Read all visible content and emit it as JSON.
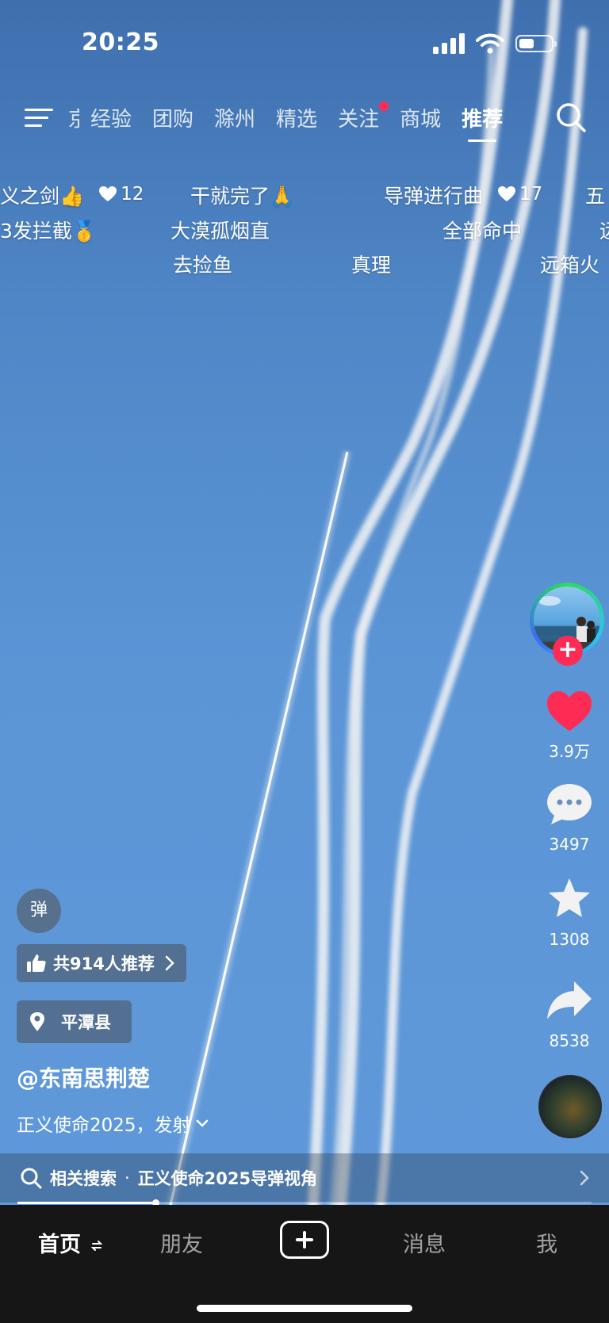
{
  "status_bar": {
    "time": "20:25"
  },
  "top_nav": {
    "tabs": [
      {
        "label": "京",
        "cut": true
      },
      {
        "label": "经验"
      },
      {
        "label": "团购"
      },
      {
        "label": "滁州"
      },
      {
        "label": "精选"
      },
      {
        "label": "关注",
        "has_dot": true
      },
      {
        "label": "商城"
      },
      {
        "label": "推荐",
        "active": true
      }
    ]
  },
  "danmaku": {
    "row1": {
      "a": "义之剑👍",
      "a_likes": "12",
      "b": "干就完了🙏",
      "c": "导弹进行曲",
      "c_likes": "17",
      "d": "五"
    },
    "row2": {
      "a": "3发拦截🥇",
      "b": "大漠孤烟直",
      "c": "全部命中",
      "d": "远"
    },
    "row3": {
      "a": "去捡鱼",
      "b": "真理",
      "c": "远箱火"
    }
  },
  "right_rail": {
    "likes": "3.9万",
    "comments": "3497",
    "favorites": "1308",
    "shares": "8538"
  },
  "info": {
    "danmaku_button": "弹",
    "recommend_chip": "共914人推荐",
    "location_chip": "平潭县",
    "author": "@东南思荆楚",
    "description": "正义使命2025，发射"
  },
  "related_search": {
    "prefix": "相关搜索",
    "separator": "·",
    "query": "正义使命2025导弹视角"
  },
  "progress": {
    "fraction": 0.24
  },
  "bottom_nav": {
    "home": "首页",
    "friends": "朋友",
    "messages": "消息",
    "me": "我"
  },
  "colors": {
    "accent": "#fe2c55",
    "like_heart": "#fe2c55",
    "nav_bg": "#161616"
  }
}
